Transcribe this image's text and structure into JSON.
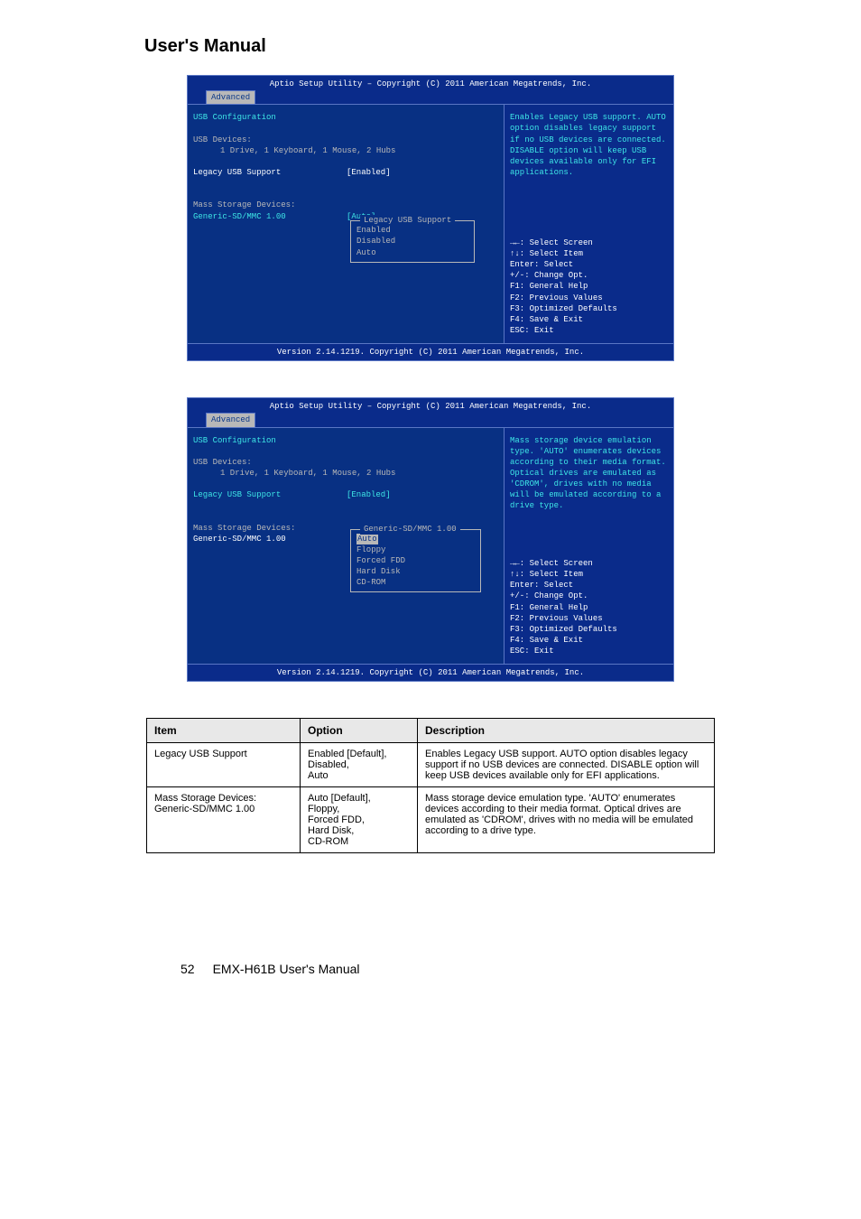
{
  "page": {
    "header_title": "User's Manual",
    "footer_page": "52",
    "footer_text": "EMX-H61B User's Manual"
  },
  "bios_common": {
    "top_title": "Aptio Setup Utility – Copyright (C) 2011 American Megatrends, Inc.",
    "tab_label": "Advanced",
    "footer_text": "Version 2.14.1219. Copyright (C) 2011 American Megatrends, Inc.",
    "left_heading": "USB Configuration",
    "usb_devices_label": "USB Devices:",
    "usb_devices_value": "1 Drive, 1 Keyboard, 1 Mouse, 2 Hubs",
    "legacy_label": "Legacy USB Support",
    "legacy_value": "[Enabled]",
    "mass_label": "Mass Storage Devices:",
    "generic_label": "Generic-SD/MMC 1.00",
    "generic_value": "[Auto]",
    "keys": {
      "k1": "→←: Select Screen",
      "k2": "↑↓: Select Item",
      "k3": "Enter: Select",
      "k4": "+/-: Change Opt.",
      "k5": "F1: General Help",
      "k6": "F2: Previous Values",
      "k7": "F3: Optimized Defaults",
      "k8": "F4: Save & Exit",
      "k9": "ESC: Exit"
    }
  },
  "bios1": {
    "help_text": "Enables Legacy USB support. AUTO option disables legacy support if no USB devices are connected. DISABLE option will keep USB devices available only for EFI applications.",
    "popup_title": "Legacy USB Support",
    "popup_options": [
      "Enabled",
      "Disabled",
      "Auto"
    ]
  },
  "bios2": {
    "help_text": "Mass storage device emulation type. 'AUTO' enumerates devices according to their media format. Optical drives are emulated as 'CDROM', drives with no media will be emulated according to a drive type.",
    "popup_title": "Generic-SD/MMC 1.00",
    "popup_options": [
      "Auto",
      "Floppy",
      "Forced FDD",
      "Hard Disk",
      "CD-ROM"
    ]
  },
  "table": {
    "h1": "Item",
    "h2": "Option",
    "h3": "Description",
    "r1": {
      "item": "Legacy USB Support",
      "opts": "Enabled [Default],\nDisabled,\nAuto",
      "desc": "Enables Legacy USB support. AUTO option disables legacy support if no USB devices are connected. DISABLE option will keep USB devices available only for EFI applications."
    },
    "r2": {
      "item": "Mass Storage Devices:\nGeneric-SD/MMC 1.00",
      "opts": "Auto [Default],\nFloppy,\nForced FDD,\nHard Disk,\nCD-ROM",
      "desc": "Mass storage device emulation type. 'AUTO' enumerates devices according to their media format. Optical drives are emulated as 'CDROM', drives with no media will be emulated according to a drive type."
    }
  }
}
